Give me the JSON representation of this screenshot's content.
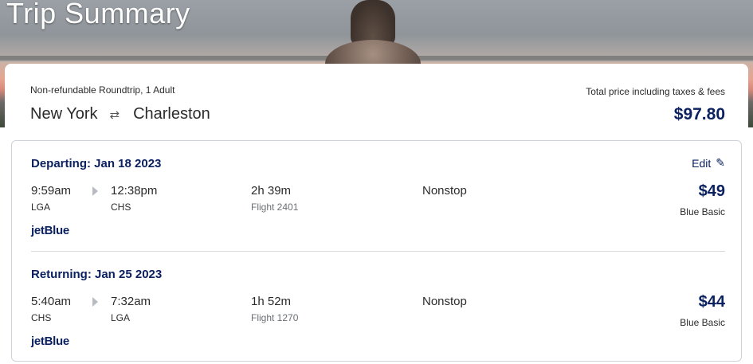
{
  "hero": {
    "title": "Trip Summary"
  },
  "summary": {
    "trip_type": "Non-refundable Roundtrip, 1 Adult",
    "origin": "New York",
    "destination": "Charleston",
    "swap_icon": "⇄",
    "total_label": "Total price including taxes & fees",
    "total_price": "$97.80"
  },
  "segments": [
    {
      "title": "Departing: Jan 18 2023",
      "edit_label": "Edit",
      "depart_time": "9:59am",
      "depart_airport": "LGA",
      "arrive_time": "12:38pm",
      "arrive_airport": "CHS",
      "duration": "2h 39m",
      "flight_number": "Flight 2401",
      "stops": "Nonstop",
      "price": "$49",
      "fare_class": "Blue Basic",
      "airline": "jetBlue"
    },
    {
      "title": "Returning: Jan 25 2023",
      "depart_time": "5:40am",
      "depart_airport": "CHS",
      "arrive_time": "7:32am",
      "arrive_airport": "LGA",
      "duration": "1h 52m",
      "flight_number": "Flight 1270",
      "stops": "Nonstop",
      "price": "$44",
      "fare_class": "Blue Basic",
      "airline": "jetBlue"
    }
  ],
  "icons": {
    "swap": "swap-arrows-icon",
    "edit": "pencil-icon",
    "direction": "right-arrow-icon"
  },
  "colors": {
    "brand_navy": "#0b2160",
    "border": "#cfd2d6"
  }
}
